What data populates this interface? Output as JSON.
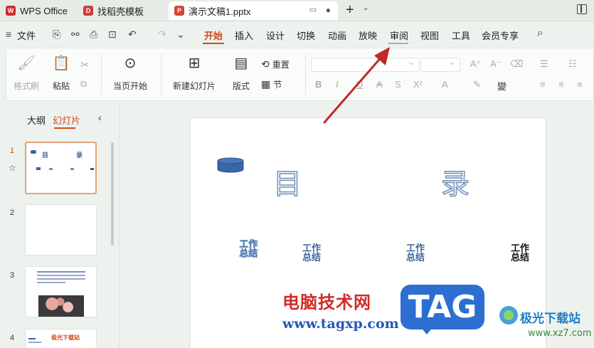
{
  "tabs": {
    "wps": "WPS Office",
    "store": "找稻壳模板",
    "doc": "演示文稿1.pptx"
  },
  "menu": {
    "file": "文件",
    "items": [
      "开始",
      "插入",
      "设计",
      "切换",
      "动画",
      "放映",
      "审阅",
      "视图",
      "工具",
      "会员专享"
    ]
  },
  "ribbon": {
    "format_painter": "格式刷",
    "paste": "粘贴",
    "play_current": "当页开始",
    "new_slide": "新建幻灯片",
    "layout": "版式",
    "reset": "重置",
    "section": "节"
  },
  "panel": {
    "outline_tab": "大纲",
    "slides_tab": "幻灯片",
    "slide_numbers": [
      "1",
      "2",
      "3",
      "4"
    ],
    "thumb1": {
      "title_a": "目",
      "title_b": "录"
    },
    "thumb4": {
      "title": "极光下载站"
    }
  },
  "slide": {
    "title_left": "目",
    "title_right": "录",
    "items": [
      {
        "line1": "工作",
        "line2": "总结"
      },
      {
        "line1": "工作",
        "line2": "总结"
      },
      {
        "line1": "工作",
        "line2": "总结"
      },
      {
        "line1": "工作",
        "line2": "总结"
      }
    ]
  },
  "watermark": {
    "site_cn": "电脑技术网",
    "site_url": "www.tagxp.com",
    "badge": "TAG",
    "brand_cn": "极光下载站",
    "brand_url": "www.xz7.com"
  },
  "colors": {
    "accent": "#d04a1c",
    "arrow": "#c0282a",
    "title_outline": "#6e90b6"
  }
}
